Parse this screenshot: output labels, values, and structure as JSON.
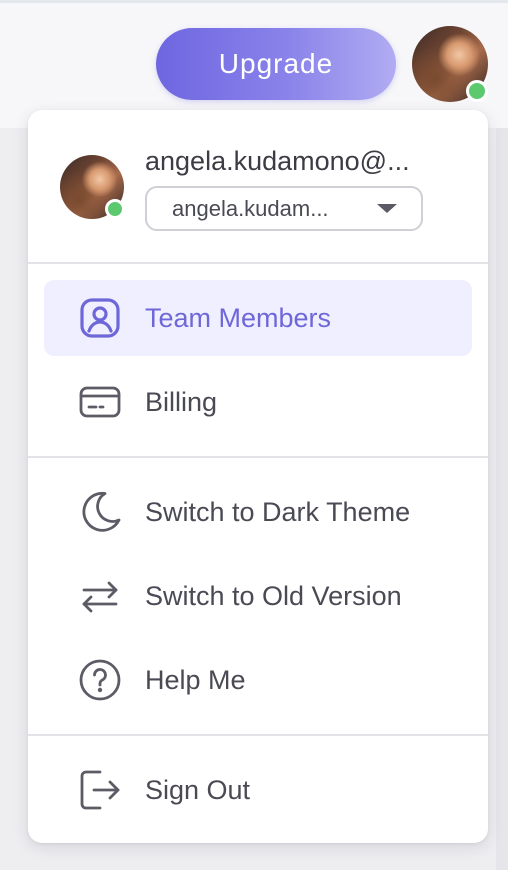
{
  "header": {
    "upgrade_label": "Upgrade"
  },
  "account": {
    "email": "angela.kudamono@...",
    "selected_account": "angela.kudam..."
  },
  "menu": {
    "items": [
      {
        "label": "Team Members",
        "icon": "user-square-icon",
        "active": true
      },
      {
        "label": "Billing",
        "icon": "credit-card-icon",
        "active": false
      },
      {
        "label": "Switch to Dark Theme",
        "icon": "moon-icon",
        "active": false
      },
      {
        "label": "Switch to Old Version",
        "icon": "swap-arrows-icon",
        "active": false
      },
      {
        "label": "Help Me",
        "icon": "help-circle-icon",
        "active": false
      },
      {
        "label": "Sign Out",
        "icon": "sign-out-icon",
        "active": false
      }
    ]
  },
  "colors": {
    "accent": "#6e67d8",
    "active_bg": "#f0efff",
    "online": "#5cc96f",
    "text": "#4a4a55"
  }
}
